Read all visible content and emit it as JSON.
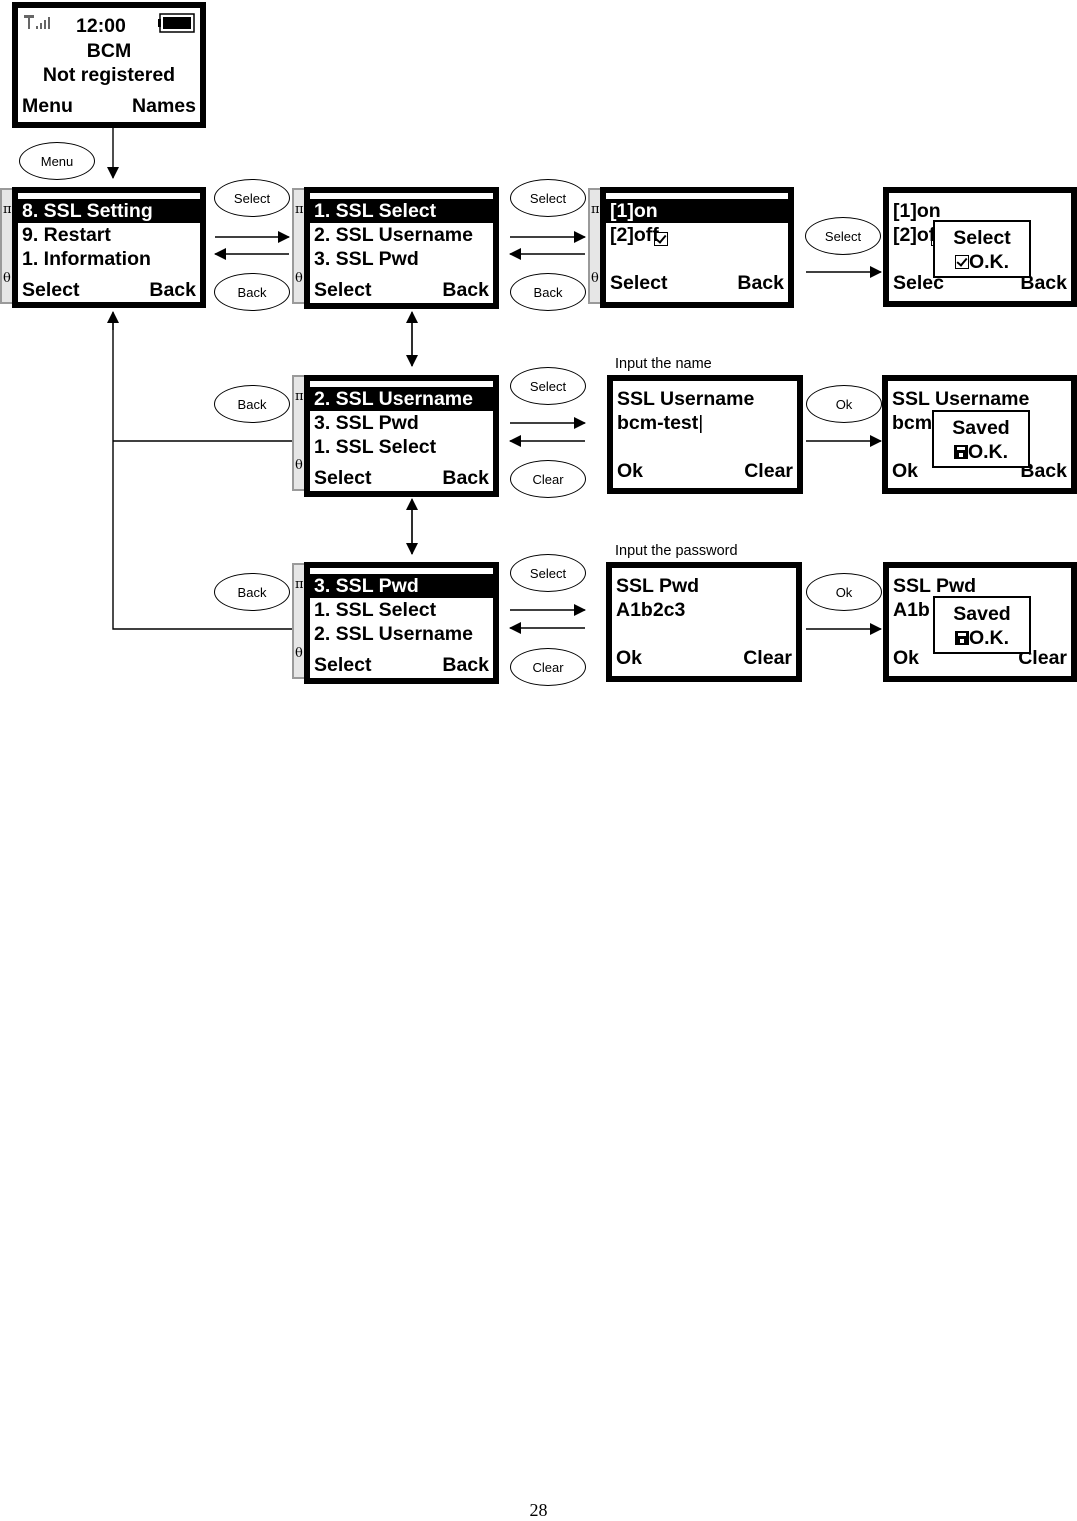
{
  "idle_screen": {
    "time": "12:00",
    "operator": "BCM",
    "status": "Not registered",
    "soft_left": "Menu",
    "soft_right": "Names",
    "signal_icon": "signal-bars-icon",
    "battery_icon": "battery-full-icon"
  },
  "transitions": {
    "menu": "Menu",
    "select": "Select",
    "back": "Back",
    "clear": "Clear",
    "ok": "Ok"
  },
  "scroll_marks": {
    "up": "π",
    "down": "θ"
  },
  "menu_screen": {
    "rows": [
      "8. SSL Setting",
      "9. Restart",
      "1. Information"
    ],
    "soft_left": "Select",
    "soft_right": "Back"
  },
  "ssl_menu_select": {
    "rows": [
      "1. SSL Select",
      "2. SSL Username",
      "3. SSL Pwd"
    ],
    "soft_left": "Select",
    "soft_right": "Back"
  },
  "ssl_menu_username": {
    "rows": [
      "2. SSL Username",
      "3. SSL Pwd",
      "1. SSL Select"
    ],
    "soft_left": "Select",
    "soft_right": "Back"
  },
  "ssl_menu_pwd": {
    "rows": [
      "3. SSL Pwd",
      "1. SSL Select",
      "2. SSL Username"
    ],
    "soft_left": "Select",
    "soft_right": "Back"
  },
  "ssl_select_screen": {
    "options": [
      "[1]on",
      "[2]off"
    ],
    "checked_index": 1,
    "soft_left": "Select",
    "soft_right": "Back"
  },
  "ssl_select_confirm": {
    "options": [
      "[1]on",
      "[2]of"
    ],
    "soft_left": "Selec",
    "soft_right": "Back",
    "popup_title": "Select",
    "popup_ok": "O.K."
  },
  "username_input": {
    "caption": "Input the name",
    "title": "SSL Username",
    "value": "bcm-test",
    "soft_left": "Ok",
    "soft_right": "Clear"
  },
  "username_saved": {
    "title": "SSL Username",
    "value": "bcm",
    "soft_left": "Ok",
    "soft_right": "Back",
    "popup_title": "Saved",
    "popup_ok": "O.K."
  },
  "pwd_input": {
    "caption": "Input the password",
    "title": "SSL Pwd",
    "value": "A1b2c3",
    "soft_left": "Ok",
    "soft_right": "Clear"
  },
  "pwd_saved": {
    "title": "SSL Pwd",
    "value": "A1b",
    "soft_left": "Ok",
    "soft_right": "Clear",
    "popup_title": "Saved",
    "popup_ok": "O.K."
  },
  "page_number": "28"
}
